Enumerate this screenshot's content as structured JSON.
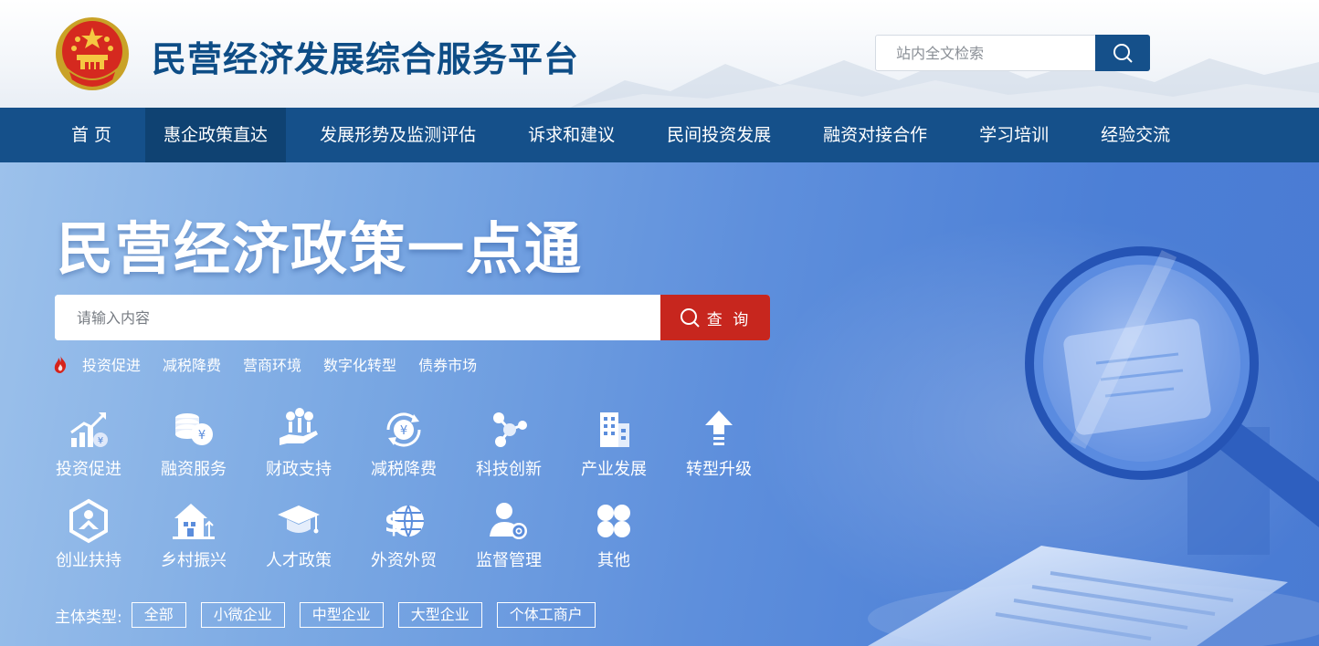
{
  "header": {
    "title": "民营经济发展综合服务平台",
    "search_placeholder": "站内全文检索"
  },
  "nav": {
    "items": [
      {
        "label": "首 页"
      },
      {
        "label": "惠企政策直达",
        "active": true
      },
      {
        "label": "发展形势及监测评估"
      },
      {
        "label": "诉求和建议"
      },
      {
        "label": "民间投资发展"
      },
      {
        "label": "融资对接合作"
      },
      {
        "label": "学习培训"
      },
      {
        "label": "经验交流"
      }
    ]
  },
  "hero": {
    "title": "民营经济政策一点通",
    "search_placeholder": "请输入内容",
    "search_button": "查 询",
    "hot_tags": [
      "投资促进",
      "减税降费",
      "营商环境",
      "数字化转型",
      "债券市场"
    ],
    "categories": [
      {
        "label": "投资促进",
        "icon": "growth-chart-icon"
      },
      {
        "label": "融资服务",
        "icon": "coin-stack-icon"
      },
      {
        "label": "财政支持",
        "icon": "hand-money-icon"
      },
      {
        "label": "减税降费",
        "icon": "yuan-cycle-icon"
      },
      {
        "label": "科技创新",
        "icon": "molecule-icon"
      },
      {
        "label": "产业发展",
        "icon": "buildings-icon"
      },
      {
        "label": "转型升级",
        "icon": "up-arrow-icon"
      },
      {
        "label": "创业扶持",
        "icon": "hexagon-people-icon"
      },
      {
        "label": "乡村振兴",
        "icon": "house-icon"
      },
      {
        "label": "人才政策",
        "icon": "graduation-cap-icon"
      },
      {
        "label": "外资外贸",
        "icon": "dollar-globe-icon"
      },
      {
        "label": "监督管理",
        "icon": "user-gear-icon"
      },
      {
        "label": "其他",
        "icon": "clover-icon"
      }
    ],
    "subject_label": "主体类型:",
    "subject_types": [
      "全部",
      "小微企业",
      "中型企业",
      "大型企业",
      "个体工商户"
    ]
  },
  "colors": {
    "brand_blue": "#15508a",
    "nav_active": "#0f4272",
    "query_red": "#c7261e",
    "title_blue": "#0e4d86"
  }
}
